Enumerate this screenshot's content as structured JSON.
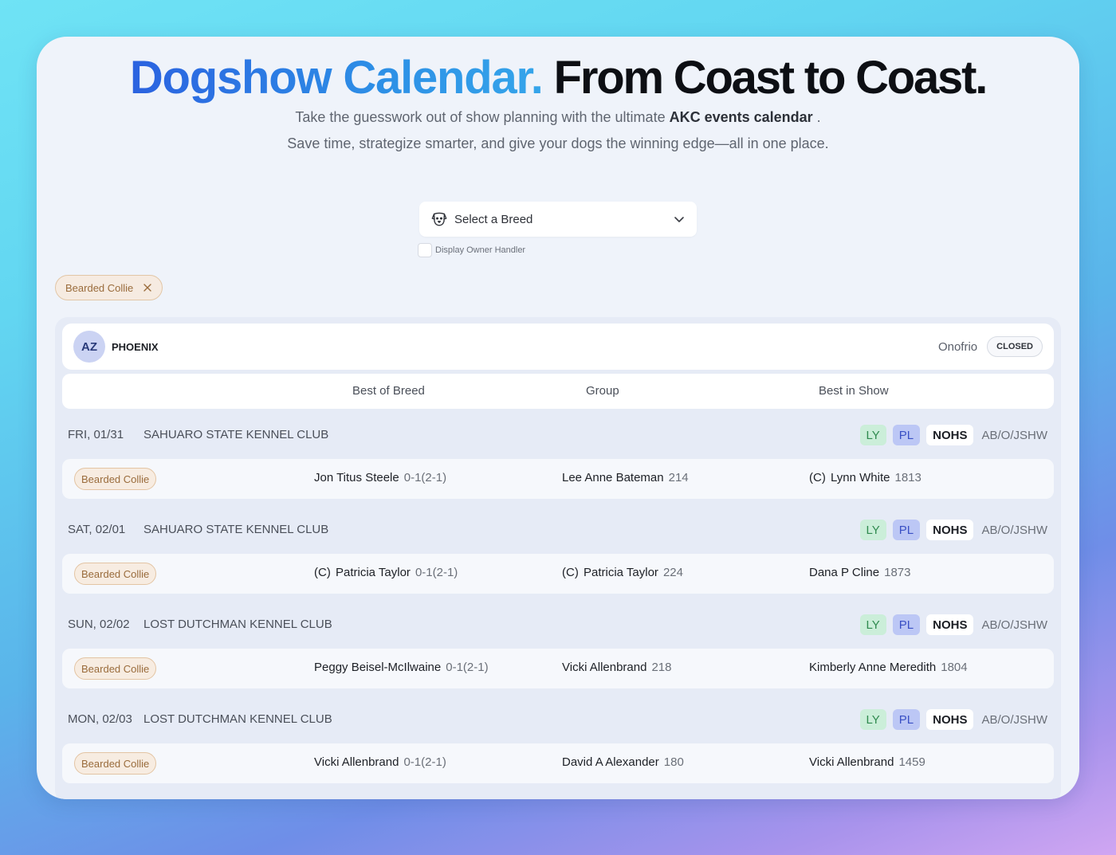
{
  "hero": {
    "title_accent": "Dogshow Calendar.",
    "title_dark": "From Coast to Coast.",
    "subtitle1_pre": "Take the guesswork out of show planning with the ultimate ",
    "subtitle1_bold": "AKC events calendar",
    "subtitle1_post": " .",
    "subtitle2": "Save time, strategize smarter, and give your dogs the winning edge—all in one place."
  },
  "breed_select": {
    "placeholder": "Select a Breed",
    "icon": "dog-face-icon"
  },
  "owner_handler": {
    "label": "Display Owner Handler",
    "checked": false
  },
  "filter_chip": {
    "label": "Bearded Collie"
  },
  "location": {
    "state": "AZ",
    "city": "PHOENIX",
    "superintendent": "Onofrio",
    "status": "CLOSED"
  },
  "columns": {
    "bob": "Best of Breed",
    "group": "Group",
    "bis": "Best in Show"
  },
  "shows": [
    {
      "date": "FRI, 01/31",
      "club": "SAHUARO STATE KENNEL CLUB",
      "tags": {
        "ly": "LY",
        "pl": "PL",
        "nohs": "NOHS",
        "classes": "AB/O/JSHW"
      },
      "breed": "Bearded Collie",
      "bob": {
        "co": "",
        "name": "Jon Titus Steele",
        "num": "0-1(2-1)"
      },
      "group": {
        "co": "",
        "name": "Lee Anne Bateman",
        "num": "214"
      },
      "bis": {
        "co": "(C)",
        "name": "Lynn White",
        "num": "1813"
      }
    },
    {
      "date": "SAT, 02/01",
      "club": "SAHUARO STATE KENNEL CLUB",
      "tags": {
        "ly": "LY",
        "pl": "PL",
        "nohs": "NOHS",
        "classes": "AB/O/JSHW"
      },
      "breed": "Bearded Collie",
      "bob": {
        "co": "(C)",
        "name": "Patricia Taylor",
        "num": "0-1(2-1)"
      },
      "group": {
        "co": "(C)",
        "name": "Patricia Taylor",
        "num": "224"
      },
      "bis": {
        "co": "",
        "name": "Dana P Cline",
        "num": "1873"
      }
    },
    {
      "date": "SUN, 02/02",
      "club": "LOST DUTCHMAN KENNEL CLUB",
      "tags": {
        "ly": "LY",
        "pl": "PL",
        "nohs": "NOHS",
        "classes": "AB/O/JSHW"
      },
      "breed": "Bearded Collie",
      "bob": {
        "co": "",
        "name": "Peggy Beisel-McIlwaine",
        "num": "0-1(2-1)"
      },
      "group": {
        "co": "",
        "name": "Vicki Allenbrand",
        "num": "218"
      },
      "bis": {
        "co": "",
        "name": "Kimberly Anne Meredith",
        "num": "1804"
      }
    },
    {
      "date": "MON, 02/03",
      "club": "LOST DUTCHMAN KENNEL CLUB",
      "tags": {
        "ly": "LY",
        "pl": "PL",
        "nohs": "NOHS",
        "classes": "AB/O/JSHW"
      },
      "breed": "Bearded Collie",
      "bob": {
        "co": "",
        "name": "Vicki Allenbrand",
        "num": "0-1(2-1)"
      },
      "group": {
        "co": "",
        "name": "David A Alexander",
        "num": "180"
      },
      "bis": {
        "co": "",
        "name": "Vicki Allenbrand",
        "num": "1459"
      }
    }
  ]
}
